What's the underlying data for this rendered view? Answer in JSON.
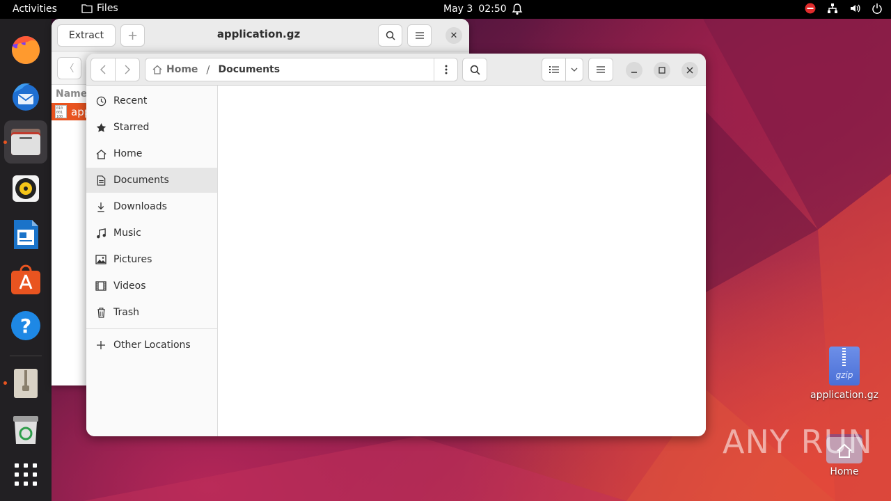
{
  "topbar": {
    "activities": "Activities",
    "app_name": "Files",
    "date": "May 3",
    "time": "02:50"
  },
  "dock": {
    "items": [
      {
        "name": "firefox"
      },
      {
        "name": "thunderbird"
      },
      {
        "name": "files"
      },
      {
        "name": "rhythmbox"
      },
      {
        "name": "libreoffice-writer"
      },
      {
        "name": "app-center"
      },
      {
        "name": "help"
      },
      {
        "name": "archive-manager"
      },
      {
        "name": "trash"
      },
      {
        "name": "show-apps"
      }
    ]
  },
  "archive_window": {
    "extract_label": "Extract",
    "title": "application.gz",
    "column_name": "Name",
    "row_name": "app"
  },
  "files_window": {
    "breadcrumb_home": "Home",
    "breadcrumb_current": "Documents",
    "sidebar": {
      "items": [
        {
          "label": "Recent",
          "icon": "clock-icon"
        },
        {
          "label": "Starred",
          "icon": "star-icon"
        },
        {
          "label": "Home",
          "icon": "home-icon"
        },
        {
          "label": "Documents",
          "icon": "document-icon"
        },
        {
          "label": "Downloads",
          "icon": "download-icon"
        },
        {
          "label": "Music",
          "icon": "music-icon"
        },
        {
          "label": "Pictures",
          "icon": "picture-icon"
        },
        {
          "label": "Videos",
          "icon": "video-icon"
        },
        {
          "label": "Trash",
          "icon": "trash-icon"
        }
      ],
      "other_locations": "Other Locations"
    }
  },
  "desktop": {
    "icons": [
      {
        "label": "application.gz",
        "badge": "gzip"
      },
      {
        "label": "Home"
      }
    ],
    "watermark": "ANY RUN"
  },
  "colors": {
    "accent": "#e95420",
    "dock_bg": "#222023",
    "topbar_bg": "#000000"
  }
}
